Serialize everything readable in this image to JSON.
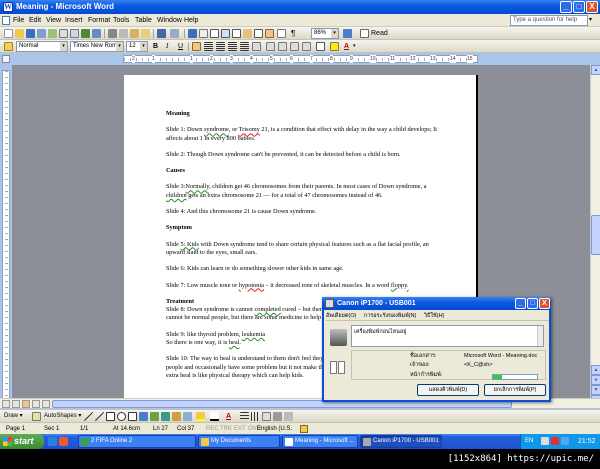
{
  "window": {
    "title": "Meaning - Microsoft Word",
    "min": "_",
    "max": "□",
    "close": "X"
  },
  "menu": {
    "items": [
      "File",
      "Edit",
      "View",
      "Insert",
      "Format",
      "Tools",
      "Table",
      "Window",
      "Help"
    ],
    "help_placeholder": "Type a question for help"
  },
  "standard_toolbar": {
    "zoom": "86%",
    "read": "Read"
  },
  "format_toolbar": {
    "style": "Normal",
    "font": "Times New Roman",
    "size": "12",
    "bold": "B",
    "italic": "I",
    "underline": "U",
    "highlight_a": "A"
  },
  "ruler": {
    "numbers": [
      "2",
      "1",
      "1",
      "2",
      "3",
      "4",
      "5",
      "6",
      "7",
      "8",
      "9",
      "10",
      "11",
      "12",
      "13",
      "14",
      "15"
    ]
  },
  "document": {
    "heading_meaning": "Meaning",
    "slide1_a": "Slide 1: Down ",
    "slide1_err1": "syndrome",
    "slide1_b": ", or ",
    "slide1_err2": "Trisomy",
    "slide1_c": " 21, is a condition that effect with delay in the way a child develops; It affects about 1 in every 800 babies.",
    "slide2": "Slide 2: Though Down syndrome can't be prevented, it can be detected before a child is born.",
    "heading_causes": "Causes",
    "slide3_a": "Slide 3:",
    "slide3_err1": "Normally",
    "slide3_b": ", children get 46 chromosomes from their parents. In most cases of Down syndrome, a ",
    "slide3_err2": "children",
    "slide3_c": " gets an extra chromosome 21 — for a total of 47 chromosomes instead of 46.",
    "slide4": "Slide 4: And this chromosome 21 is cause Down syndrome.",
    "heading_symptom": "Symptom",
    "slide5_a": "Slide ",
    "slide5_err": "5: Kids",
    "slide5_b": " with Down syndrome tend to share certain physical features such as a flat facial profile, an upward slant to the eyes, small ears.",
    "slide6": "Slide 6: Kids can learn or do something slower other kids in same age.",
    "slide7_a": "Slide 7: Low muscle tone or ",
    "slide7_err1": "hypotonia",
    "slide7_b": " – it decreased tone of skeletal muscles. In a word ",
    "slide7_err2": "floppy.",
    "heading_treatment": "Treatment",
    "slide8_a": "Slide 8: Down syndrome is cannot ",
    "slide8_err": "completed",
    "slide8_b": " cured – but there are many treatment which can help but it cannot be normal people, but there are some medicine to help kids in some problems.",
    "slide9_a": "Slide 9: like thyroid problem,  ",
    "slide9_err1": "leukemia",
    "slide9_b": "So there is one way, it is ",
    "slide9_err2": "heal",
    "slide9_c": ".",
    "slide10": "Slide 10: The way to heal is understand to them don't feel they are different from others, you do with normal people and occasionally have some problem but it not make them different from normal people. And other extra heal is like physical therapy which can help kids."
  },
  "draw_toolbar": {
    "draw": "Draw ▾",
    "autoshapes": "AutoShapes ▾"
  },
  "status": {
    "page": "Page  1",
    "sec": "Sec  1",
    "pages": "1/1",
    "at": "At  14.6cm",
    "ln": "Ln  27",
    "col": "Col  37",
    "rec": "REC",
    "trk": "TRK",
    "ext": "EXT",
    "ovr": "OVR",
    "lang": "English (U.S."
  },
  "taskbar": {
    "start": "start",
    "tasks": [
      "2 FIFA Online 2",
      "My Documents",
      "Meaning - Microsoft ...",
      "Canon iP1700 - USB001"
    ],
    "lang": "EN",
    "clock": "21:52"
  },
  "dialog": {
    "title": "Canon iP1700 - USB001",
    "menu": [
      "อัพเดียยต(O)",
      "การอระรังของพิมพ์(N)",
      "วิธีใช้(H)"
    ],
    "message": "เครื่องพิมพ์ก่อนไหนอยู่",
    "doc_label": "ชื่อเอกสาร:",
    "doc_value": "Microsoft Word - Meaning.doc",
    "owner_label": "เจ้าของ:",
    "owner_value": "<K_C@sh>",
    "printing_label": "หน้ากำรพิมพ์:",
    "progress_pct": 0.2,
    "btn_queue": "แสดงคิวพิมพ์(D)",
    "btn_cancel": "ยกเลิกการพิมพ์(P)"
  },
  "watermark": "[1152x864] https://upic.me/"
}
